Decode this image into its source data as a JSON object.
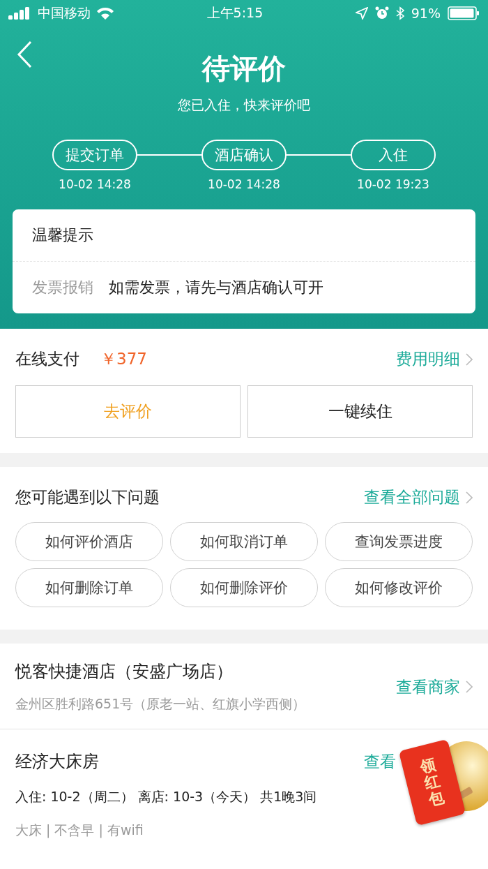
{
  "status_bar": {
    "carrier": "中国移动",
    "time": "上午5:15",
    "battery": "91%"
  },
  "header": {
    "title": "待评价",
    "subtitle": "您已入住，快来评价吧"
  },
  "steps": [
    {
      "label": "提交订单",
      "time": "10-02 14:28"
    },
    {
      "label": "酒店确认",
      "time": "10-02 14:28"
    },
    {
      "label": "入住",
      "time": "10-02 19:23"
    }
  ],
  "notice": {
    "title": "温馨提示",
    "label": "发票报销",
    "text": "如需发票，请先与酒店确认可开"
  },
  "payment": {
    "label": "在线支付",
    "amount": "￥377",
    "link": "费用明细"
  },
  "actions": [
    {
      "label": "去评价",
      "kind": "primary"
    },
    {
      "label": "一键续住",
      "kind": "normal"
    }
  ],
  "faq": {
    "title": "您可能遇到以下问题",
    "link": "查看全部问题",
    "questions": [
      "如何评价酒店",
      "如何取消订单",
      "查询发票进度",
      "如何删除订单",
      "如何删除评价",
      "如何修改评价"
    ]
  },
  "hotel": {
    "name": "悦客快捷酒店（安盛广场店）",
    "address": "金州区胜利路651号（原老一站、红旗小学西侧）",
    "link": "查看商家"
  },
  "room": {
    "name": "经济大床房",
    "link": "查看",
    "stay": "入住: 10-2（周二） 离店: 10-3（今天） 共1晚3间",
    "features": "大床 | 不含早 | 有wifi"
  },
  "promo": {
    "label": "领红包"
  }
}
